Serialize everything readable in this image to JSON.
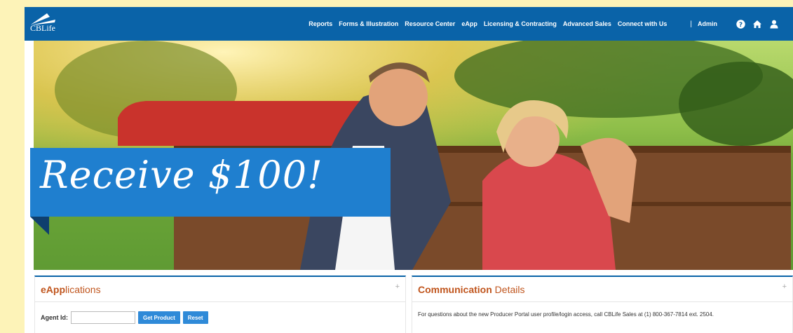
{
  "header": {
    "logo_text": "CBLife",
    "nav": [
      {
        "label": "Reports"
      },
      {
        "label": "Forms & Illustration"
      },
      {
        "label": "Resource Center"
      },
      {
        "label": "eApp"
      },
      {
        "label": "Licensing & Contracting"
      },
      {
        "label": "Advanced Sales"
      },
      {
        "label": "Connect with Us"
      }
    ],
    "separator": "|",
    "admin_label": "Admin",
    "icons": [
      "help-icon",
      "home-icon",
      "user-icon"
    ]
  },
  "hero": {
    "banner_text": "Receive $100!"
  },
  "eapplications": {
    "title_bold": "eApp",
    "title_rest": "lications",
    "agent_id_label": "Agent Id:",
    "agent_id_value": "",
    "get_product_label": "Get Product",
    "reset_label": "Reset"
  },
  "communication": {
    "title_bold": "Communication",
    "title_rest": " Details",
    "message": "For questions about the new Producer Portal user profile/login access, call CBLife Sales at (1) 800-367-7814 ext. 2504."
  },
  "colors": {
    "brand_blue": "#0a63a8",
    "accent_orange": "#c0551d",
    "button_blue": "#2f8ad8",
    "page_background": "#fdf3b8"
  }
}
